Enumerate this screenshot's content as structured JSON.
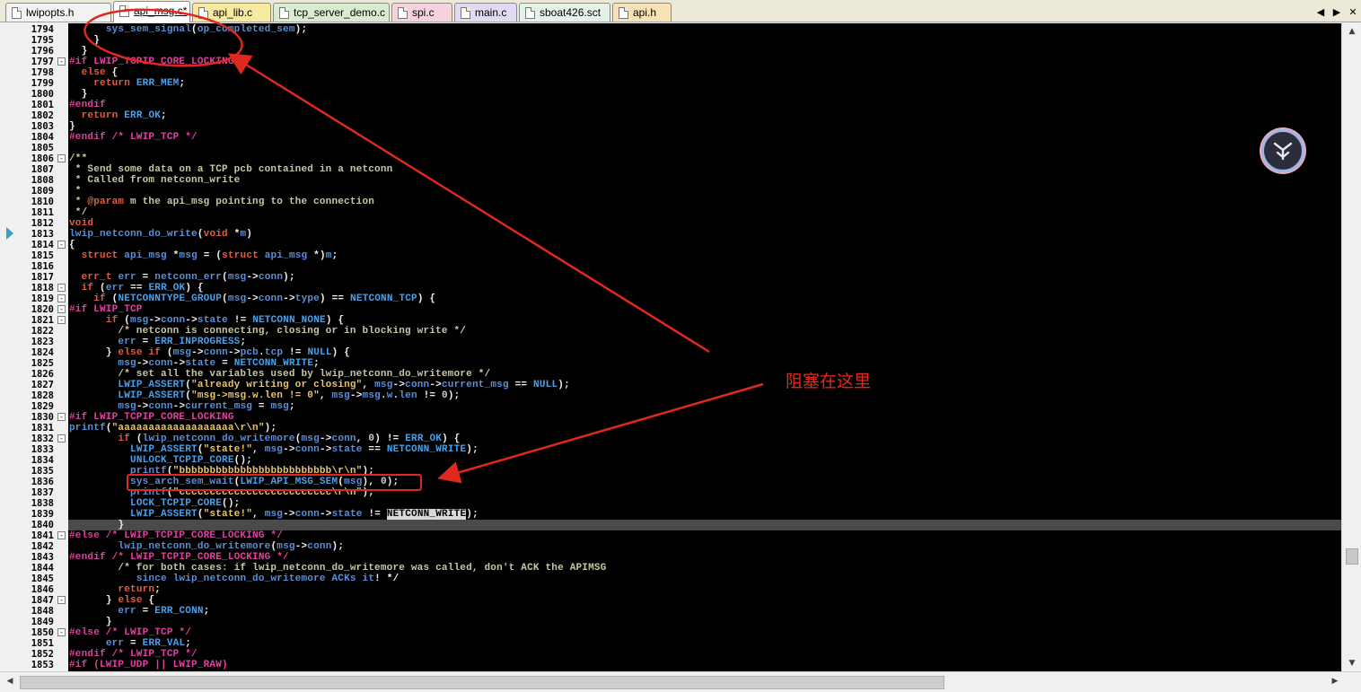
{
  "tabs": [
    {
      "label": "lwipopts.h",
      "color": "#f2f2f2"
    },
    {
      "label": "api_msg.c*",
      "color": "#ffffff",
      "active": true
    },
    {
      "label": "api_lib.c",
      "color": "#f7e9a0"
    },
    {
      "label": "tcp_server_demo.c",
      "color": "#d9ecd0"
    },
    {
      "label": "spi.c",
      "color": "#f6d2dc"
    },
    {
      "label": "main.c",
      "color": "#e2d9f2"
    },
    {
      "label": "sboat426.sct",
      "color": "#e4f2ea"
    },
    {
      "label": "api.h",
      "color": "#f7e2b8"
    }
  ],
  "tab_controls": {
    "left": "◀",
    "right": "▶",
    "close": "✕"
  },
  "line_numbers": [
    "1794",
    "1795",
    "1796",
    "1797",
    "1798",
    "1799",
    "1800",
    "1801",
    "1802",
    "1803",
    "1804",
    "1805",
    "1806",
    "1807",
    "1808",
    "1809",
    "1810",
    "1811",
    "1812",
    "1813",
    "1814",
    "1815",
    "1816",
    "1817",
    "1818",
    "1819",
    "1820",
    "1821",
    "1822",
    "1823",
    "1824",
    "1825",
    "1826",
    "1827",
    "1828",
    "1829",
    "1830",
    "1831",
    "1832",
    "1833",
    "1834",
    "1835",
    "1836",
    "1837",
    "1838",
    "1839",
    "1840",
    "1841",
    "1842",
    "1843",
    "1844",
    "1845",
    "1846",
    "1847",
    "1848",
    "1849",
    "1850",
    "1851",
    "1852",
    "1853"
  ],
  "code_lines": [
    "      sys_sem_signal(op_completed_sem);",
    "    }",
    "  }",
    "#if LWIP_TCPIP_CORE_LOCKING",
    "  else {",
    "    return ERR_MEM;",
    "  }",
    "#endif",
    "  return ERR_OK;",
    "}",
    "#endif /* LWIP_TCP */",
    "",
    "/**",
    " * Send some data on a TCP pcb contained in a netconn",
    " * Called from netconn_write",
    " *",
    " * @param m the api_msg pointing to the connection",
    " */",
    "void",
    "lwip_netconn_do_write(void *m)",
    "{",
    "  struct api_msg *msg = (struct api_msg *)m;",
    "",
    "  err_t err = netconn_err(msg->conn);",
    "  if (err == ERR_OK) {",
    "    if (NETCONNTYPE_GROUP(msg->conn->type) == NETCONN_TCP) {",
    "#if LWIP_TCP",
    "      if (msg->conn->state != NETCONN_NONE) {",
    "        /* netconn is connecting, closing or in blocking write */",
    "        err = ERR_INPROGRESS;",
    "      } else if (msg->conn->pcb.tcp != NULL) {",
    "        msg->conn->state = NETCONN_WRITE;",
    "        /* set all the variables used by lwip_netconn_do_writemore */",
    "        LWIP_ASSERT(\"already writing or closing\", msg->conn->current_msg == NULL);",
    "        LWIP_ASSERT(\"msg->msg.w.len != 0\", msg->msg.w.len != 0);",
    "        msg->conn->current_msg = msg;",
    "#if LWIP_TCPIP_CORE_LOCKING",
    "printf(\"aaaaaaaaaaaaaaaaaaa\\r\\n\");",
    "        if (lwip_netconn_do_writemore(msg->conn, 0) != ERR_OK) {",
    "          LWIP_ASSERT(\"state!\", msg->conn->state == NETCONN_WRITE);",
    "          UNLOCK_TCPIP_CORE();",
    "          printf(\"bbbbbbbbbbbbbbbbbbbbbbbbb\\r\\n\");",
    "          sys_arch_sem_wait(LWIP_API_MSG_SEM(msg), 0);",
    "          printf(\"ccccccccccccccccccccccccc\\r\\n\");",
    "          LOCK_TCPIP_CORE();",
    "          LWIP_ASSERT(\"state!\", msg->conn->state != NETCONN_WRITE);",
    "        }",
    "#else /* LWIP_TCPIP_CORE_LOCKING */",
    "        lwip_netconn_do_writemore(msg->conn);",
    "#endif /* LWIP_TCPIP_CORE_LOCKING */",
    "        /* for both cases: if lwip_netconn_do_writemore was called, don't ACK the APIMSG",
    "           since lwip_netconn_do_writemore ACKs it! */",
    "        return;",
    "      } else {",
    "        err = ERR_CONN;",
    "      }",
    "#else /* LWIP_TCP */",
    "      err = ERR_VAL;",
    "#endif /* LWIP_TCP */",
    "#if (LWIP_UDP || LWIP_RAW)"
  ],
  "annotation": {
    "label": "阻塞在这里",
    "color": "#e0281e"
  }
}
